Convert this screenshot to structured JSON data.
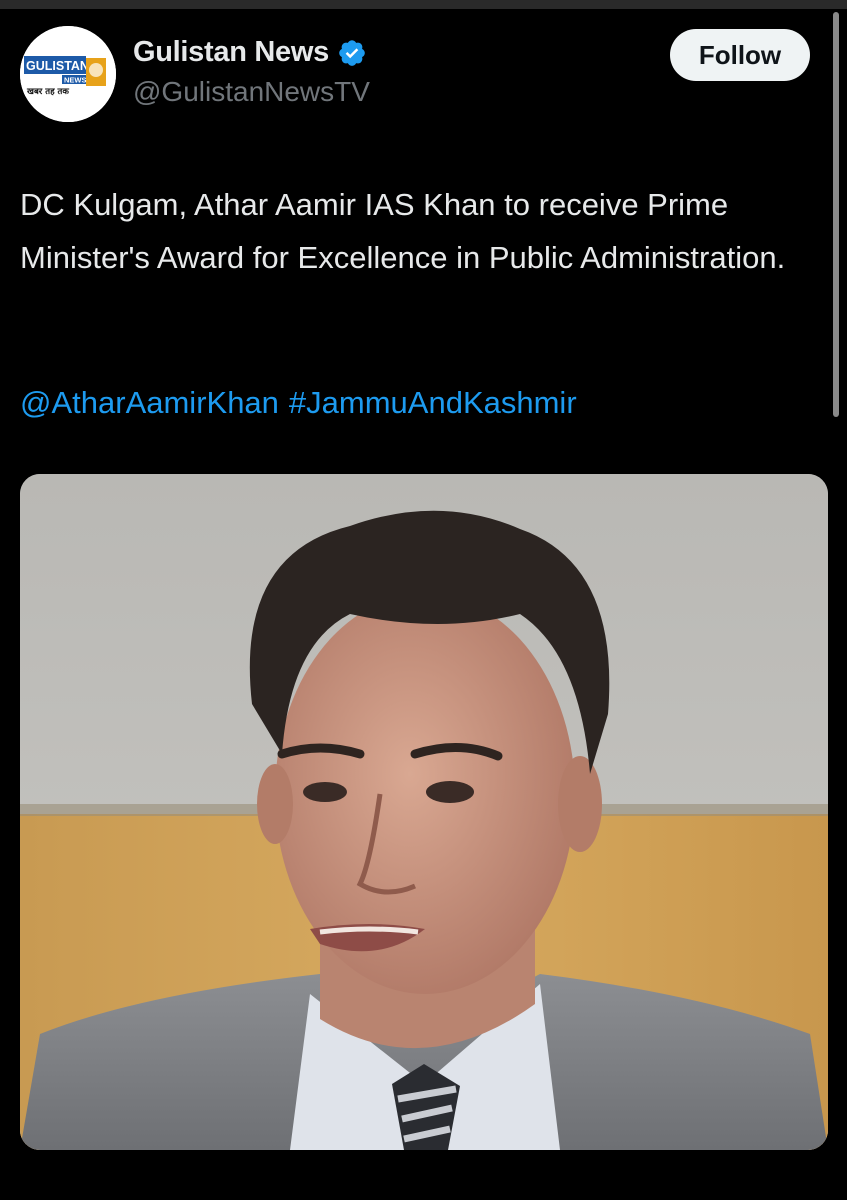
{
  "account": {
    "display_name": "Gulistan News",
    "handle": "@GulistanNewsTV",
    "verified": true,
    "avatar_logo": {
      "brand": "GULISTAN",
      "sub": "NEWS",
      "tagline": "खबर तह तक"
    }
  },
  "follow_button": {
    "label": "Follow"
  },
  "tweet": {
    "text": "DC Kulgam, Athar Aamir IAS Khan to receive Prime Minister's Award for Excellence in Public Administration.",
    "mention": "@AtharAamirKhan",
    "hashtag": "#JammuAndKashmir"
  },
  "media": {
    "icon": "photo-portrait"
  },
  "colors": {
    "background": "#000000",
    "text": "#e7e9ea",
    "muted": "#71767b",
    "link": "#1d9bf0",
    "verified_badge": "#1d9bf0",
    "follow_bg": "#eff3f4"
  }
}
